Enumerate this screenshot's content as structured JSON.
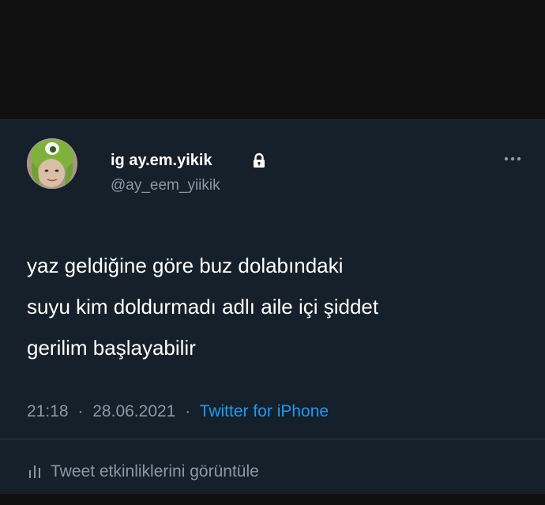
{
  "user": {
    "display_name": "ig ay.em.yikik",
    "handle": "@ay_eem_yiikik",
    "protected_icon": "lock-icon"
  },
  "tweet": {
    "lines": [
      "yaz geldiğine göre buz dolabındaki",
      "suyu kim doldurmadı adlı aile içi şiddet",
      "gerilim başlayabilir"
    ],
    "time": "21:18",
    "date": "28.06.2021",
    "separator": "·",
    "source": "Twitter for iPhone"
  },
  "actions": {
    "more_icon": "more-dots-icon",
    "analytics_icon": "bar-chart-icon",
    "analytics_label": "Tweet etkinliklerini görüntüle"
  },
  "colors": {
    "background": "#15202b",
    "text_primary": "#ffffff",
    "text_secondary": "#8b98a5",
    "accent": "#1d9bf0"
  }
}
